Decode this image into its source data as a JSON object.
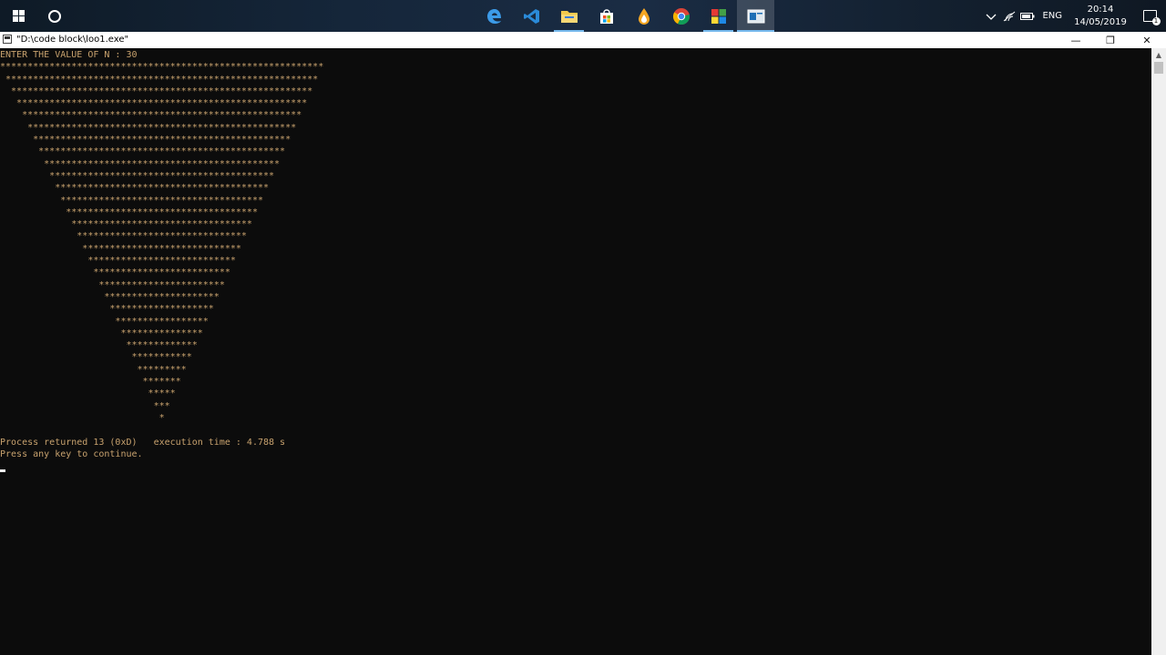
{
  "taskbar": {
    "apps": [
      {
        "name": "edge",
        "icon": "edge-icon",
        "running": false
      },
      {
        "name": "vscode",
        "icon": "vscode-icon",
        "running": false
      },
      {
        "name": "file-explorer",
        "icon": "folder-icon",
        "running": true
      },
      {
        "name": "store",
        "icon": "store-icon",
        "running": false
      },
      {
        "name": "drop",
        "icon": "drop-icon",
        "running": false
      },
      {
        "name": "chrome",
        "icon": "chrome-icon",
        "running": false
      },
      {
        "name": "codeblocks",
        "icon": "codeblocks-icon",
        "running": true
      },
      {
        "name": "console",
        "icon": "console-icon",
        "running": true,
        "active": true
      }
    ],
    "tray": {
      "language": "ENG",
      "time": "20:14",
      "date": "14/05/2019",
      "notification_count": "1"
    }
  },
  "window": {
    "title": "\"D:\\code block\\loo1.exe\"",
    "minimize_glyph": "—",
    "maximize_glyph": "❐",
    "close_glyph": "✕"
  },
  "console": {
    "prompt": "ENTER THE VALUE OF N : ",
    "n_value": "30",
    "pattern_rows": 30,
    "pattern_char": "*",
    "process_line": "Process returned 13 (0xD)   execution time : 4.788 s",
    "continue_line": "Press any key to continue."
  },
  "colors": {
    "console_bg": "#0c0c0c",
    "console_text": "#c8a26e",
    "taskbar_accent": "#76b9ed"
  }
}
